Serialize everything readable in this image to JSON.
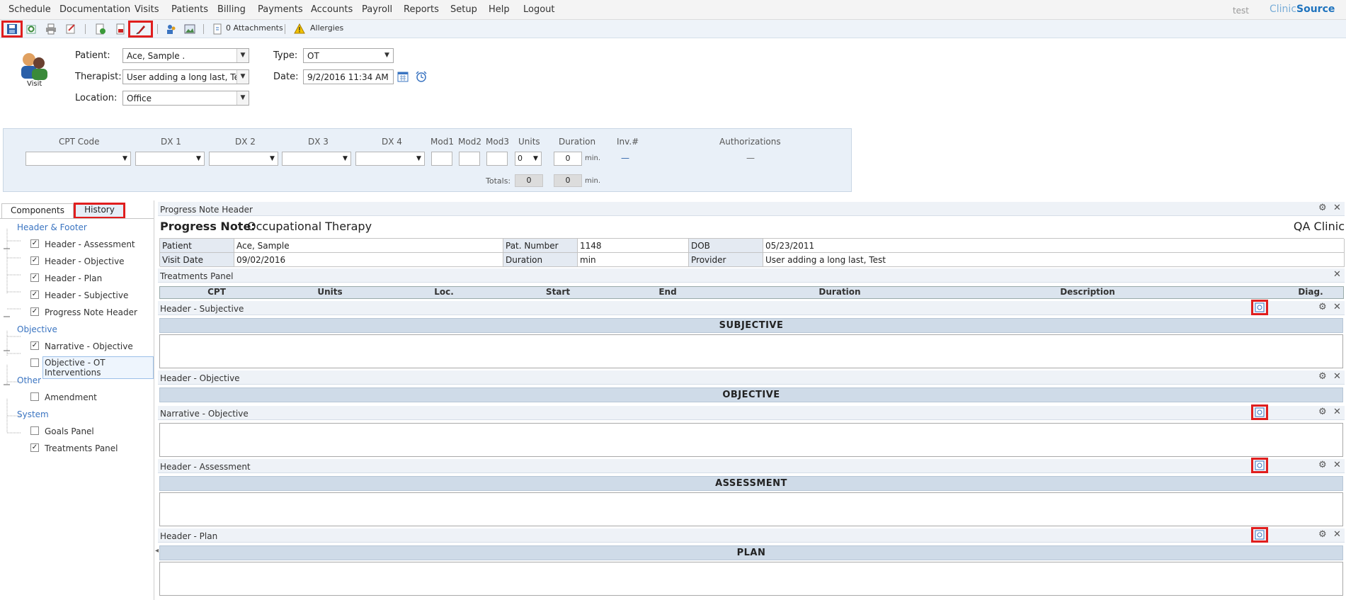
{
  "menu": [
    "Schedule",
    "Documentation",
    "Visits",
    "Patients",
    "Billing",
    "Payments",
    "Accounts",
    "Payroll",
    "Reports",
    "Setup",
    "Help",
    "Logout"
  ],
  "brand": {
    "user": "test",
    "logo_a": "Clinic",
    "logo_b": "Source"
  },
  "toolbar": {
    "attachments": "0 Attachments",
    "allergies": "Allergies"
  },
  "visit": {
    "icon_label": "Visit",
    "patient_label": "Patient:",
    "patient_value": "Ace, Sample  .",
    "therapist_label": "Therapist:",
    "therapist_value": "User adding a long last, Test",
    "location_label": "Location:",
    "location_value": "Office",
    "type_label": "Type:",
    "type_value": "OT",
    "date_label": "Date:",
    "date_value": "9/2/2016 11:34 AM"
  },
  "cpt": {
    "headers": [
      "CPT Code",
      "DX 1",
      "DX 2",
      "DX 3",
      "DX 4",
      "Mod1",
      "Mod2",
      "Mod3",
      "Units",
      "Duration",
      "Inv.#",
      "Authorizations"
    ],
    "units_value": "0",
    "duration_value": "0",
    "min": "min.",
    "inv_value": "—",
    "auth_value": "—",
    "totals_label": "Totals:",
    "totals_units": "0",
    "totals_duration": "0"
  },
  "left": {
    "tabs": [
      "Components",
      "History"
    ],
    "groups": [
      {
        "label": "Header & Footer",
        "items": [
          {
            "label": "Header - Assessment",
            "checked": true
          },
          {
            "label": "Header - Objective",
            "checked": true
          },
          {
            "label": "Header - Plan",
            "checked": true
          },
          {
            "label": "Header - Subjective",
            "checked": true
          },
          {
            "label": "Progress Note Header",
            "checked": true
          }
        ]
      },
      {
        "label": "Objective",
        "items": [
          {
            "label": "Narrative - Objective",
            "checked": true
          },
          {
            "label": "Objective - OT Interventions",
            "checked": false
          }
        ]
      },
      {
        "label": "Other",
        "items": [
          {
            "label": "Amendment",
            "checked": false
          }
        ]
      },
      {
        "label": "System",
        "items": [
          {
            "label": "Goals Panel",
            "checked": false
          },
          {
            "label": "Treatments Panel",
            "checked": true
          }
        ]
      }
    ]
  },
  "note": {
    "header_title": "Progress Note Header",
    "pn_label": "Progress Note:",
    "pn_type": "Occupational Therapy",
    "clinic": "QA Clinic",
    "info": [
      [
        "Patient",
        "Ace, Sample",
        "Pat. Number",
        "1148",
        "DOB",
        "05/23/2011"
      ],
      [
        "Visit Date",
        "09/02/2016",
        "Duration",
        " min",
        "Provider",
        "User adding a long last, Test"
      ]
    ],
    "treatments_title": "Treatments Panel",
    "treatment_cols": [
      "CPT",
      "Units",
      "Loc.",
      "Start",
      "End",
      "Duration",
      "Description",
      "Diag."
    ],
    "sections": [
      {
        "title": "Header - Subjective",
        "band": "SUBJECTIVE"
      },
      {
        "title": "Header - Objective",
        "band": "OBJECTIVE"
      },
      {
        "title": "Narrative - Objective",
        "band": ""
      },
      {
        "title": "Header - Assessment",
        "band": "ASSESSMENT"
      },
      {
        "title": "Header - Plan",
        "band": "PLAN"
      }
    ]
  },
  "icons": {
    "gear": "gear-icon",
    "close": "close-icon"
  },
  "colors": {
    "highlight": "#e01e1e",
    "link": "#3a74c1",
    "band": "#cfdbe8"
  }
}
